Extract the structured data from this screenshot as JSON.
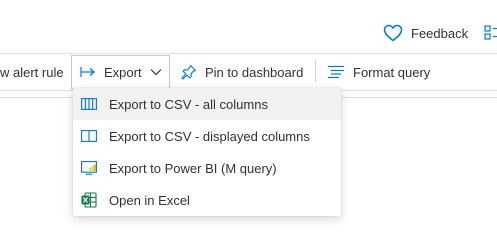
{
  "header": {
    "feedback_label": "Feedback",
    "feedback_icon": "heart-icon",
    "more_icon": "more-grid-icon"
  },
  "toolbar": {
    "alert_label": "w alert rule",
    "export_label": "Export",
    "pin_label": "Pin to dashboard",
    "format_label": "Format query"
  },
  "export_menu": {
    "items": [
      {
        "label": "Export to CSV - all columns",
        "icon": "csv-all-columns-icon"
      },
      {
        "label": "Export to CSV - displayed columns",
        "icon": "csv-displayed-columns-icon"
      },
      {
        "label": "Export to Power BI (M query)",
        "icon": "power-bi-icon"
      },
      {
        "label": "Open in Excel",
        "icon": "excel-icon"
      }
    ]
  },
  "colors": {
    "accent": "#0078d4",
    "excel_green": "#107c41",
    "hover_bg": "#f3f2f1",
    "border": "#c8c6c4"
  }
}
